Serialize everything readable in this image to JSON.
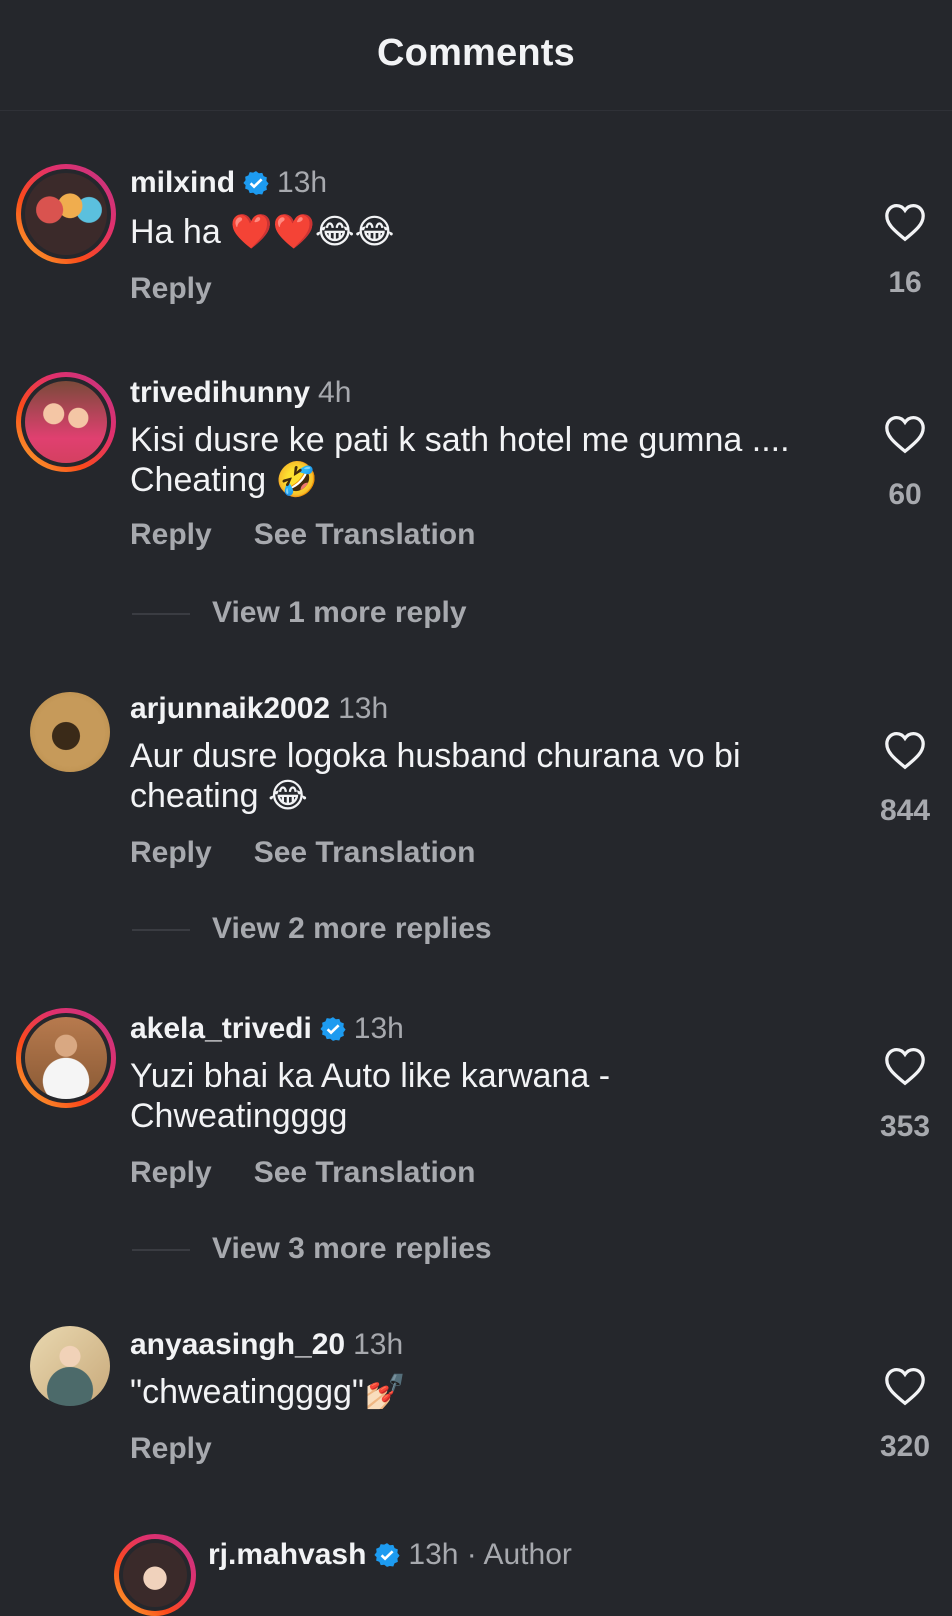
{
  "header": {
    "title": "Comments"
  },
  "comments": [
    {
      "username": "milxind",
      "verified": true,
      "time": "13h",
      "text": "Ha ha ❤️❤️😂😂",
      "reply_label": "Reply",
      "likes": "16"
    },
    {
      "username": "trivedihunny",
      "verified": false,
      "time": "4h",
      "text": "Kisi dusre ke pati k sath hotel me gumna .... Cheating 🤣",
      "reply_label": "Reply",
      "translate_label": "See Translation",
      "likes": "60",
      "view_more": "View 1 more reply"
    },
    {
      "username": "arjunnaik2002",
      "verified": false,
      "time": "13h",
      "text": "Aur dusre logoka husband churana vo bi cheating 😂",
      "reply_label": "Reply",
      "translate_label": "See Translation",
      "likes": "844",
      "view_more": "View 2 more replies"
    },
    {
      "username": "akela_trivedi",
      "verified": true,
      "time": "13h",
      "text": "Yuzi bhai ka Auto like karwana - Chweatingggg",
      "reply_label": "Reply",
      "translate_label": "See Translation",
      "likes": "353",
      "view_more": "View 3 more replies"
    },
    {
      "username": "anyaasingh_20",
      "verified": false,
      "time": "13h",
      "text": "\"chweatingggg\"💅🏻",
      "reply_label": "Reply",
      "likes": "320"
    },
    {
      "username": "rj.mahvash",
      "verified": true,
      "time": "13h · Author"
    }
  ],
  "colors": {
    "background": "#25272c",
    "verified": "#1d9bf0",
    "muted": "#a7a9ae"
  }
}
